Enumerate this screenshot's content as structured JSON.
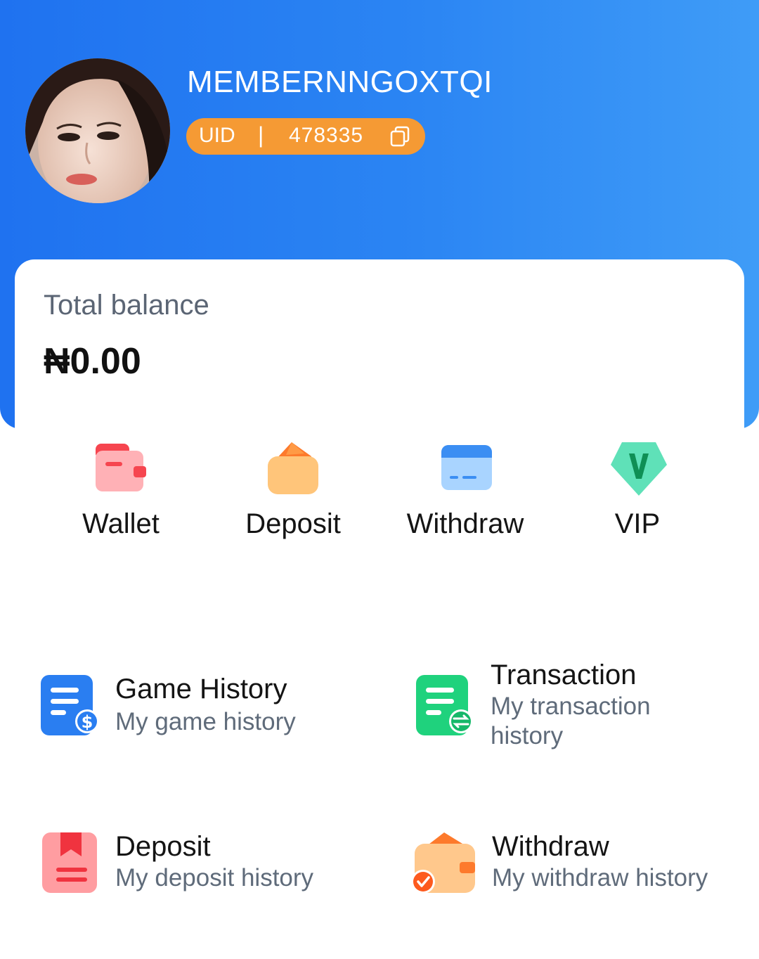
{
  "profile": {
    "username": "MEMBERNNGOXTQI",
    "uid_label": "UID",
    "uid_separator": "|",
    "uid_value": "478335"
  },
  "balance": {
    "label": "Total balance",
    "value": "₦0.00"
  },
  "quick_actions": [
    {
      "label": "Wallet",
      "icon": "wallet-icon"
    },
    {
      "label": "Deposit",
      "icon": "deposit-icon"
    },
    {
      "label": "Withdraw",
      "icon": "withdraw-card-icon"
    },
    {
      "label": "VIP",
      "icon": "vip-badge-icon"
    }
  ],
  "history": [
    {
      "title": "Game History",
      "subtitle": "My game history",
      "icon": "game-history-icon"
    },
    {
      "title": "Transaction",
      "subtitle": "My transaction history",
      "icon": "transaction-history-icon"
    },
    {
      "title": "Deposit",
      "subtitle": "My deposit history",
      "icon": "deposit-history-icon"
    },
    {
      "title": "Withdraw",
      "subtitle": "My withdraw history",
      "icon": "withdraw-history-icon"
    }
  ],
  "colors": {
    "header_blue": "#2b85f3",
    "uid_orange": "#f59a34",
    "wallet_red": "#f6454f",
    "deposit_orange": "#fd7a2c",
    "withdraw_blue": "#3b8ef3",
    "vip_green": "#5fe1b8",
    "history_blue": "#2a7ef1",
    "history_green": "#1fd27d"
  }
}
